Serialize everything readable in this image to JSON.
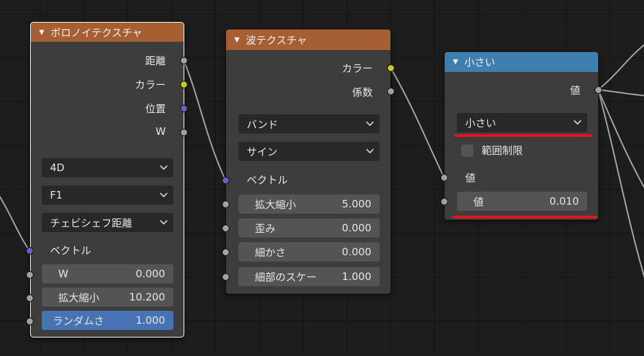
{
  "voronoi": {
    "title": "ボロノイテクスチャ",
    "outputs": [
      "距離",
      "カラー",
      "位置",
      "W"
    ],
    "dims": "4D",
    "feature": "F1",
    "metric": "チェビシェフ距離",
    "vector_label": "ベクトル",
    "fields": [
      {
        "label": "W",
        "value": "0.000"
      },
      {
        "label": "拡大縮小",
        "value": "10.200"
      },
      {
        "label": "ランダムさ",
        "value": "1.000"
      }
    ]
  },
  "wave": {
    "title": "波テクスチャ",
    "outputs": [
      "カラー",
      "係数"
    ],
    "type": "バンド",
    "profile": "サイン",
    "vector_label": "ベクトル",
    "fields": [
      {
        "label": "拡大縮小",
        "value": "5.000"
      },
      {
        "label": "歪み",
        "value": "0.000"
      },
      {
        "label": "細かさ",
        "value": "0.000"
      },
      {
        "label": "細部のスケー",
        "value": "1.000"
      }
    ]
  },
  "math": {
    "title": "小さい",
    "output": "値",
    "operation": "小さい",
    "clamp_label": "範囲制限",
    "input_label": "値",
    "field": {
      "label": "値",
      "value": "0.010"
    }
  },
  "colors": {
    "texture_header": "#a55f32",
    "converter_header": "#3f7fb0",
    "socket_float": "#a1a1a1",
    "socket_color": "#c7c729",
    "socket_vector": "#6363c7",
    "annotation": "#e8141b"
  }
}
